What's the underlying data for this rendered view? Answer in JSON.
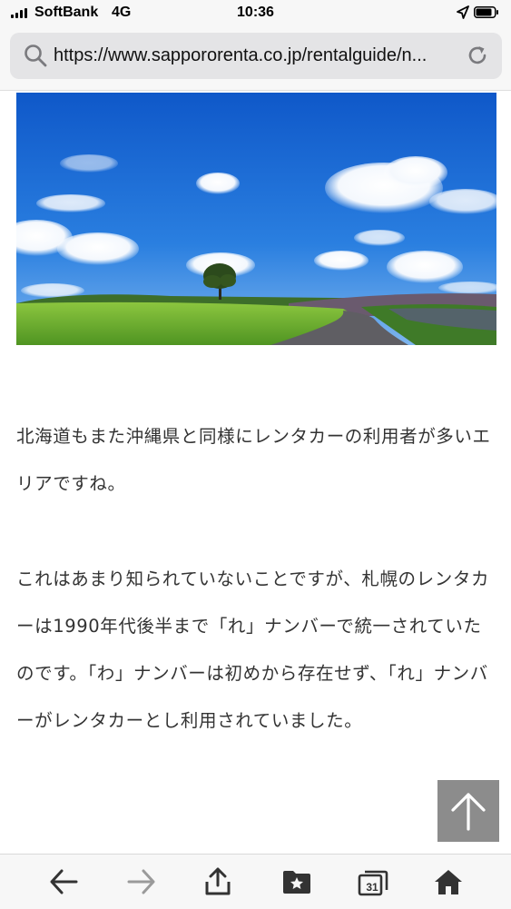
{
  "status_bar": {
    "carrier": "SoftBank",
    "network": "4G",
    "time": "10:36"
  },
  "browser": {
    "url": "https://www.sappororenta.co.jp/rentalguide/n..."
  },
  "article": {
    "hero_image": "landscape-with-lone-tree",
    "paragraphs": [
      "北海道もまた沖縄県と同様にレンタカーの利用者が多いエリアですね。",
      "これはあまり知られていないことですが、札幌のレンタカーは1990年代後半まで「れ」ナンバーで統一されていたのです。「わ」ナンバーは初めから存在せず、「れ」ナンバーがレンタカーとし利用されていました。"
    ]
  },
  "toolbar": {
    "tabs_count": "31",
    "icons": [
      "back-icon",
      "forward-icon",
      "share-icon",
      "bookmarks-icon",
      "tabs-icon",
      "home-icon"
    ]
  },
  "colors": {
    "sky": "#1f6fd6",
    "grass": "#6cae2c",
    "back_to_top": "#8c8c8c"
  }
}
